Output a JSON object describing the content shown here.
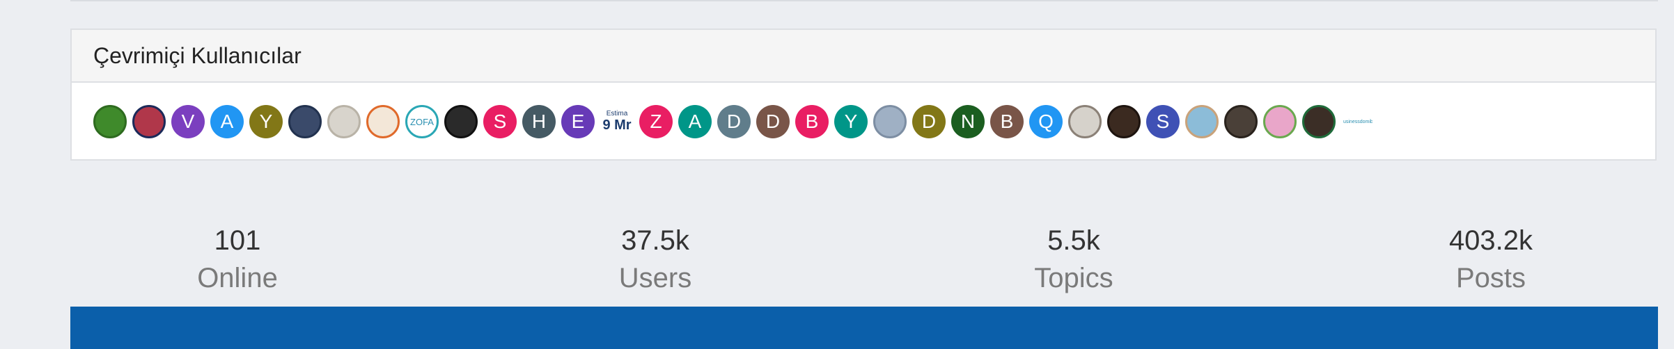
{
  "online_panel": {
    "title": "Çevrimiçi Kullanıcılar",
    "avatars": [
      {
        "kind": "image",
        "icon": "kermit-frog-avatar",
        "bg": "#3f8a2b",
        "border": "#2e6b1f"
      },
      {
        "kind": "image",
        "icon": "flag-collage-avatar",
        "bg": "#b0374a",
        "border": "#1c2a5a"
      },
      {
        "kind": "letter",
        "letter": "V",
        "bg": "#7b3fbf"
      },
      {
        "kind": "letter",
        "letter": "A",
        "bg": "#2196f3"
      },
      {
        "kind": "letter",
        "letter": "Y",
        "bg": "#827717"
      },
      {
        "kind": "image",
        "icon": "baseball-cap-photo-avatar",
        "bg": "#3a4a6a",
        "border": "#22324f"
      },
      {
        "kind": "image",
        "icon": "paper-sign-photo-avatar",
        "bg": "#d8d4cc",
        "border": "#b9b3a7"
      },
      {
        "kind": "image",
        "icon": "cartoon-character-avatar",
        "bg": "#f3e7d8",
        "border": "#e06a2b"
      },
      {
        "kind": "image",
        "icon": "brand-logo-avatar",
        "bg": "#ffffff",
        "border": "#2aa7b5",
        "caption": "ZOFA"
      },
      {
        "kind": "image",
        "icon": "portrait-photo-avatar",
        "bg": "#2a2a2a",
        "border": "#111111"
      },
      {
        "kind": "letter",
        "letter": "S",
        "bg": "#e91e63"
      },
      {
        "kind": "letter",
        "letter": "H",
        "bg": "#455a64"
      },
      {
        "kind": "letter",
        "letter": "E",
        "bg": "#673ab7"
      },
      {
        "kind": "image",
        "icon": "estima-logo-avatar",
        "bg": "#ffffff",
        "border": "#ffffff",
        "caption_top": "Estima",
        "caption_bottom": "9 Mr"
      },
      {
        "kind": "letter",
        "letter": "Z",
        "bg": "#e91e63"
      },
      {
        "kind": "letter",
        "letter": "A",
        "bg": "#009688"
      },
      {
        "kind": "letter",
        "letter": "D",
        "bg": "#607d8b"
      },
      {
        "kind": "letter",
        "letter": "D",
        "bg": "#795548"
      },
      {
        "kind": "letter",
        "letter": "B",
        "bg": "#e91e63"
      },
      {
        "kind": "letter",
        "letter": "Y",
        "bg": "#009688"
      },
      {
        "kind": "image",
        "icon": "fighter-jet-photo-avatar",
        "bg": "#9fb0c4",
        "border": "#7d8ea3"
      },
      {
        "kind": "letter",
        "letter": "D",
        "bg": "#827717"
      },
      {
        "kind": "letter",
        "letter": "N",
        "bg": "#1b5e20"
      },
      {
        "kind": "letter",
        "letter": "B",
        "bg": "#795548"
      },
      {
        "kind": "letter",
        "letter": "Q",
        "bg": "#2196f3"
      },
      {
        "kind": "image",
        "icon": "paper-document-photo-avatar",
        "bg": "#d6d2cb",
        "border": "#8b8177"
      },
      {
        "kind": "image",
        "icon": "bearded-man-photo-avatar",
        "bg": "#3b2a20",
        "border": "#1e140f"
      },
      {
        "kind": "letter",
        "letter": "S",
        "bg": "#3f51b5"
      },
      {
        "kind": "image",
        "icon": "beach-photo-avatar",
        "bg": "#8cbcd8",
        "border": "#c9a27a"
      },
      {
        "kind": "image",
        "icon": "man-with-glasses-photo-avatar",
        "bg": "#4a4038",
        "border": "#2a231d"
      },
      {
        "kind": "image",
        "icon": "cartoon-pink-avatar",
        "bg": "#e9a6c9",
        "border": "#6aa84f"
      },
      {
        "kind": "image",
        "icon": "man-in-suit-photo-avatar",
        "bg": "#3b2e26",
        "border": "#1f6b3a"
      },
      {
        "kind": "image",
        "icon": "business-logo-avatar",
        "bg": "#ffffff",
        "border": "#ffffff",
        "caption": "Businessdomibu"
      }
    ]
  },
  "stats": [
    {
      "value": "101",
      "label": "Online"
    },
    {
      "value": "37.5k",
      "label": "Users"
    },
    {
      "value": "5.5k",
      "label": "Topics"
    },
    {
      "value": "403.2k",
      "label": "Posts"
    }
  ],
  "colors": {
    "page_bg": "#eceef2",
    "footer_bar": "#0b5faa"
  }
}
